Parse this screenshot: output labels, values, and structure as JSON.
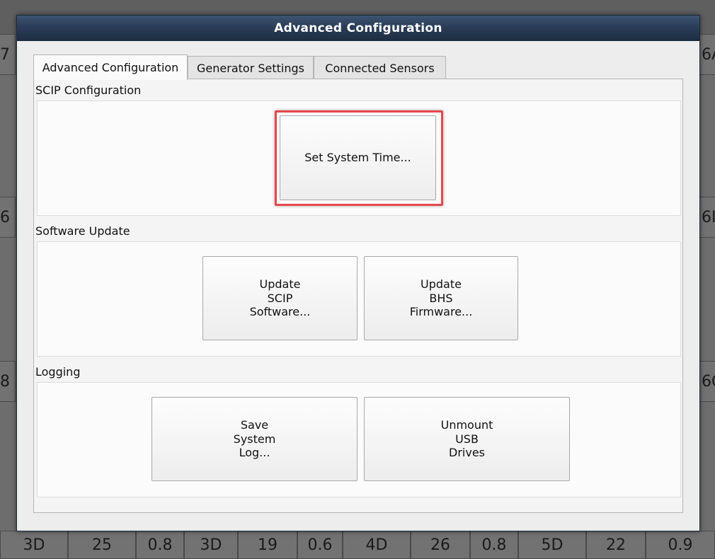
{
  "background": {
    "top_left_text": "",
    "left_cells": [
      "7",
      "6",
      "8"
    ],
    "right_cells": [
      "6A",
      "6I",
      "6C"
    ],
    "bottom_cells": [
      "3D",
      "25",
      "0.8",
      "3D",
      "19",
      "0.6",
      "4D",
      "26",
      "0.8",
      "5D",
      "22",
      "0.9"
    ]
  },
  "dialog": {
    "title": "Advanced Configuration",
    "tabs": [
      {
        "label": "Advanced Configuration",
        "active": true
      },
      {
        "label": "Generator Settings",
        "active": false
      },
      {
        "label": "Connected Sensors",
        "active": false
      }
    ],
    "sections": {
      "scip": {
        "label": "SCIP Configuration",
        "buttons": [
          {
            "lines": [
              "Set System Time..."
            ]
          }
        ]
      },
      "software_update": {
        "label": "Software Update",
        "buttons": [
          {
            "lines": [
              "Update",
              "SCIP",
              "Software..."
            ]
          },
          {
            "lines": [
              "Update",
              "BHS",
              "Firmware..."
            ]
          }
        ]
      },
      "logging": {
        "label": "Logging",
        "buttons": [
          {
            "lines": [
              "Save",
              "System",
              "Log..."
            ]
          },
          {
            "lines": [
              "Unmount",
              "USB",
              "Drives"
            ]
          }
        ]
      }
    }
  },
  "colors": {
    "titlebar": "#2c3f5a",
    "highlight": "#e5484d"
  }
}
